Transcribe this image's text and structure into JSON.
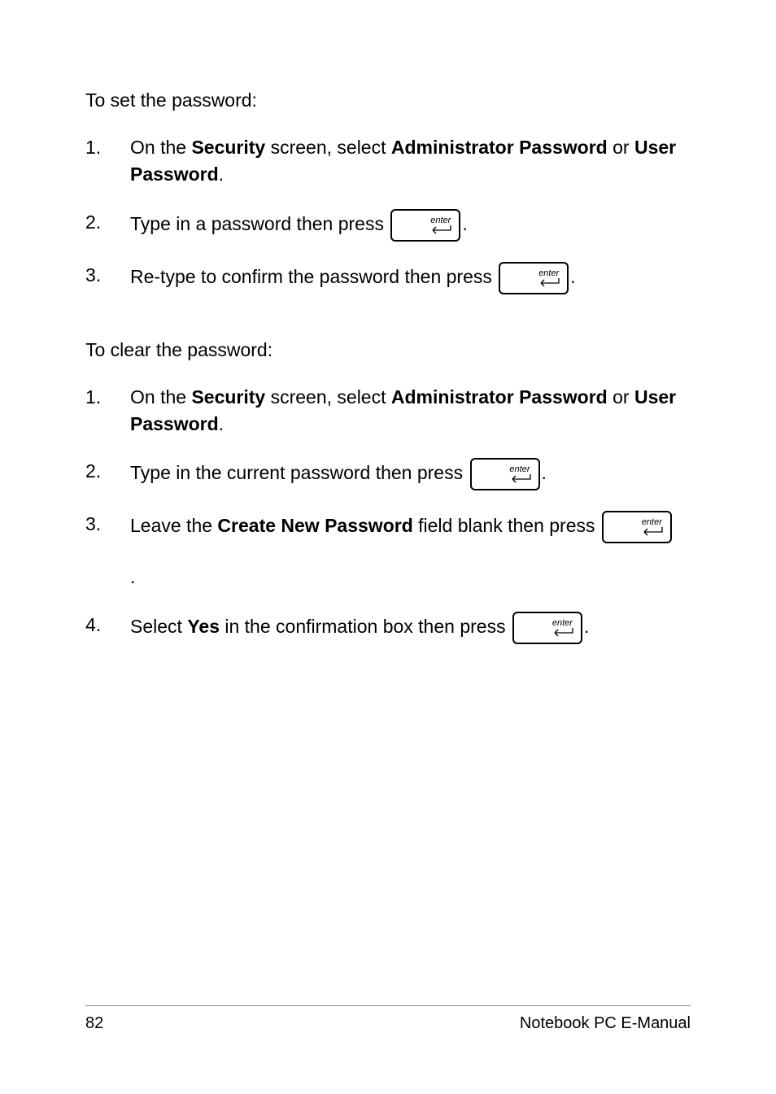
{
  "section1": {
    "intro": "To set the password:",
    "steps": [
      {
        "num": "1.",
        "pre": "On the ",
        "bold1": "Security",
        "mid1": " screen, select ",
        "bold2": "Administrator Password",
        "mid2": " or ",
        "bold3": "User Password",
        "post": "."
      },
      {
        "num": "2.",
        "pre": "Type in a password then press ",
        "post": "."
      },
      {
        "num": "3.",
        "pre": "Re-type to confirm the password then press ",
        "post": "."
      }
    ]
  },
  "section2": {
    "intro": "To clear the password:",
    "steps": [
      {
        "num": "1.",
        "pre": "On the ",
        "bold1": "Security",
        "mid1": " screen, select ",
        "bold2": "Administrator Password",
        "mid2": " or ",
        "bold3": "User Password",
        "post": "."
      },
      {
        "num": "2.",
        "pre": "Type in the current password then press ",
        "post": "."
      },
      {
        "num": "3.",
        "pre": "Leave the ",
        "bold1": "Create New Password",
        "mid1": " field blank then press ",
        "post": "."
      },
      {
        "num": "4.",
        "pre": "Select ",
        "bold1": "Yes",
        "mid1": " in the confirmation box then press ",
        "post": "."
      }
    ]
  },
  "enter_key_label": "enter",
  "footer": {
    "page_number": "82",
    "title": "Notebook PC E-Manual"
  }
}
